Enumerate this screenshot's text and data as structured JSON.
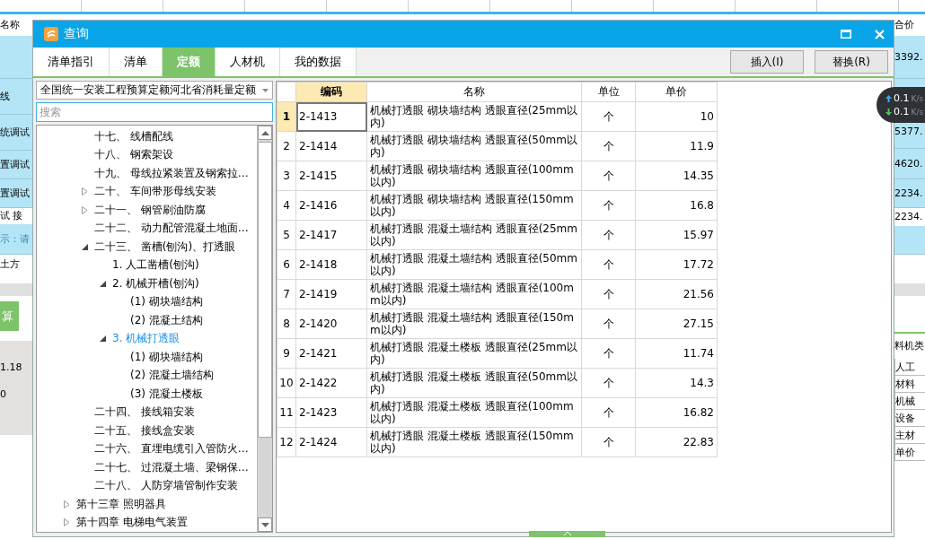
{
  "background": {
    "left_column": [
      {
        "kind": "header",
        "text": "名称"
      },
      {
        "kind": "blue"
      },
      {
        "kind": "blue",
        "text": "线"
      },
      {
        "kind": "blue",
        "text": "统调试"
      },
      {
        "kind": "blue",
        "text": "置调试"
      },
      {
        "kind": "blue",
        "text": "置调试"
      },
      {
        "kind": "white",
        "text": "试 接"
      },
      {
        "kind": "hint",
        "text": "示：请"
      },
      {
        "kind": "white",
        "text": "土方"
      },
      {
        "kind": "white"
      },
      {
        "kind": "gray"
      },
      {
        "kind": "white"
      },
      {
        "kind": "button",
        "text": "算"
      },
      {
        "kind": "white"
      },
      {
        "kind": "panel"
      },
      {
        "kind": "panel",
        "text": "1.18"
      },
      {
        "kind": "panel",
        "text": "0"
      },
      {
        "kind": "panel"
      },
      {
        "kind": "white"
      }
    ],
    "right_column": [
      {
        "kind": "header",
        "text": "合价"
      },
      {
        "kind": "blue",
        "text": "3392."
      },
      {
        "kind": "blue"
      },
      {
        "kind": "blue",
        "text": "5377."
      },
      {
        "kind": "blue",
        "text": "4620."
      },
      {
        "kind": "blue",
        "text": "2234."
      },
      {
        "kind": "white",
        "text": "2234."
      },
      {
        "kind": "blue"
      },
      {
        "kind": "white"
      },
      {
        "kind": "gray"
      },
      {
        "kind": "white"
      },
      {
        "kind": "subheader",
        "text": "料机类"
      },
      {
        "kind": "cell",
        "text": "人工"
      },
      {
        "kind": "cell",
        "text": "材料"
      },
      {
        "kind": "cell",
        "text": "机械"
      },
      {
        "kind": "cell",
        "text": "设备"
      },
      {
        "kind": "cell",
        "text": "主材"
      },
      {
        "kind": "cell",
        "text": "单价"
      },
      {
        "kind": "white"
      }
    ],
    "net_speed": [
      {
        "kind": "upload",
        "value": "0.1",
        "unit": "K/s"
      },
      {
        "kind": "download",
        "value": "0.1",
        "unit": "K/s"
      }
    ]
  },
  "dialog": {
    "title": "查询",
    "tabs": [
      {
        "label": "清单指引",
        "selected": false
      },
      {
        "label": "清单",
        "selected": false
      },
      {
        "label": "定额",
        "selected": true
      },
      {
        "label": "人材机",
        "selected": false
      },
      {
        "label": "我的数据",
        "selected": false
      }
    ],
    "buttons": [
      "插入(I)",
      "替换(R)"
    ],
    "library": {
      "value": "全国统一安装工程预算定额河北省消耗量定额"
    },
    "search": {
      "placeholder": "搜索"
    },
    "tree": {
      "continued_children": [
        {
          "label": "十七、 线槽配线",
          "selected": false
        },
        {
          "label": "十八、 钢索架设",
          "selected": false
        },
        {
          "label": "十九、 母线拉紧装置及钢索拉…",
          "selected": false
        },
        {
          "label": "二十、 车间带形母线安装",
          "expanded": false,
          "selected": false
        },
        {
          "label": "二十一、 钢管刷油防腐",
          "expanded": false,
          "selected": false
        },
        {
          "label": "二十二、 动力配管混凝土地面…",
          "selected": false
        },
        {
          "label": "二十三、 凿槽(刨沟)、打透眼",
          "expanded": true,
          "selected": false,
          "children": [
            {
              "label": "1. 人工凿槽(刨沟)",
              "selected": false
            },
            {
              "label": "2. 机械开槽(刨沟)",
              "expanded": true,
              "selected": false,
              "children": [
                {
                  "label": "(1) 砌块墙结构",
                  "selected": false
                },
                {
                  "label": "(2) 混凝土结构",
                  "selected": false
                }
              ]
            },
            {
              "label": "3. 机械打透眼",
              "expanded": true,
              "selected": true,
              "children": [
                {
                  "label": "(1) 砌块墙结构",
                  "selected": false
                },
                {
                  "label": "(2) 混凝土墙结构",
                  "selected": false
                },
                {
                  "label": "(3) 混凝土楼板",
                  "selected": false
                }
              ]
            }
          ]
        },
        {
          "label": "二十四、 接线箱安装",
          "selected": false
        },
        {
          "label": "二十五、 接线盒安装",
          "selected": false
        },
        {
          "label": "二十六、 直埋电缆引入管防火…",
          "selected": false
        },
        {
          "label": "二十七、 过混凝土墙、梁钢保…",
          "selected": false
        },
        {
          "label": "二十八、 人防穿墙管制作安装",
          "selected": false
        }
      ],
      "items": [
        {
          "label": "第十三章 照明器具",
          "expanded": false,
          "selected": false
        },
        {
          "label": "第十四章 电梯电气装置",
          "expanded": false,
          "selected": false
        }
      ]
    },
    "table": {
      "columns": [
        {
          "label": "编码",
          "selected": true
        },
        {
          "label": "名称",
          "selected": false
        },
        {
          "label": "单位",
          "selected": false
        },
        {
          "label": "单价",
          "selected": false
        }
      ],
      "rows": [
        {
          "index": "1",
          "code": "2-1413",
          "name": "机械打透眼 砌块墙结构 透眼直径(25mm以内)",
          "unit": "个",
          "price": "10",
          "selected": true
        },
        {
          "index": "2",
          "code": "2-1414",
          "name": "机械打透眼 砌块墙结构 透眼直径(50mm以内)",
          "unit": "个",
          "price": "11.9",
          "selected": false
        },
        {
          "index": "3",
          "code": "2-1415",
          "name": "机械打透眼 砌块墙结构 透眼直径(100mm以内)",
          "unit": "个",
          "price": "14.35",
          "selected": false
        },
        {
          "index": "4",
          "code": "2-1416",
          "name": "机械打透眼 砌块墙结构 透眼直径(150mm以内)",
          "unit": "个",
          "price": "16.8",
          "selected": false
        },
        {
          "index": "5",
          "code": "2-1417",
          "name": "机械打透眼 混凝土墙结构 透眼直径(25mm以内)",
          "unit": "个",
          "price": "15.97",
          "selected": false
        },
        {
          "index": "6",
          "code": "2-1418",
          "name": "机械打透眼 混凝土墙结构 透眼直径(50mm以内)",
          "unit": "个",
          "price": "17.72",
          "selected": false
        },
        {
          "index": "7",
          "code": "2-1419",
          "name": "机械打透眼 混凝土墙结构 透眼直径(100mm以内)",
          "unit": "个",
          "price": "21.56",
          "selected": false
        },
        {
          "index": "8",
          "code": "2-1420",
          "name": "机械打透眼 混凝土墙结构 透眼直径(150mm以内)",
          "unit": "个",
          "price": "27.15",
          "selected": false
        },
        {
          "index": "9",
          "code": "2-1421",
          "name": "机械打透眼 混凝土楼板 透眼直径(25mm以内)",
          "unit": "个",
          "price": "11.74",
          "selected": false
        },
        {
          "index": "10",
          "code": "2-1422",
          "name": "机械打透眼 混凝土楼板 透眼直径(50mm以内)",
          "unit": "个",
          "price": "14.3",
          "selected": false
        },
        {
          "index": "11",
          "code": "2-1423",
          "name": "机械打透眼 混凝土楼板 透眼直径(100mm以内)",
          "unit": "个",
          "price": "16.82",
          "selected": false
        },
        {
          "index": "12",
          "code": "2-1424",
          "name": "机械打透眼 混凝土楼板 透眼直径(150mm以内)",
          "unit": "个",
          "price": "22.83",
          "selected": false
        }
      ]
    }
  }
}
